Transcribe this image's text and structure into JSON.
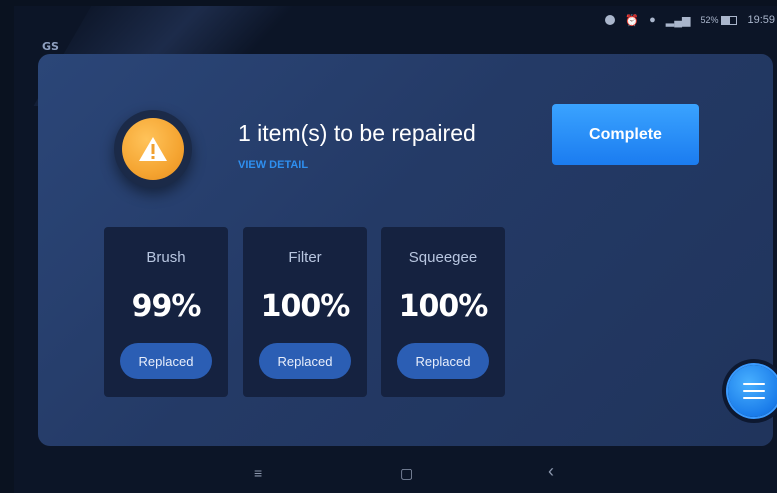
{
  "app": {
    "logo_text": "GS"
  },
  "status_bar": {
    "icons": [
      "notification-icon",
      "alarm-icon",
      "location-icon",
      "signal-icon"
    ],
    "battery_text": "52%",
    "battery_level": 0.52,
    "time": "19:59"
  },
  "alert": {
    "icon": "warning-icon",
    "title": "1 item(s) to be repaired",
    "link_label": "VIEW DETAIL",
    "complete_label": "Complete"
  },
  "parts": [
    {
      "name": "Brush",
      "percent": "99%",
      "button": "Replaced"
    },
    {
      "name": "Filter",
      "percent": "100%",
      "button": "Replaced"
    },
    {
      "name": "Squeegee",
      "percent": "100%",
      "button": "Replaced"
    }
  ],
  "fab": {
    "icon": "menu-icon"
  },
  "nav": {
    "menu": "≡",
    "home": "▢",
    "back": "‹"
  },
  "colors": {
    "accent": "#1b7cf0",
    "warning": "#f5a532",
    "panel": "#243a66",
    "card": "#152240",
    "link": "#2e8ff0"
  }
}
